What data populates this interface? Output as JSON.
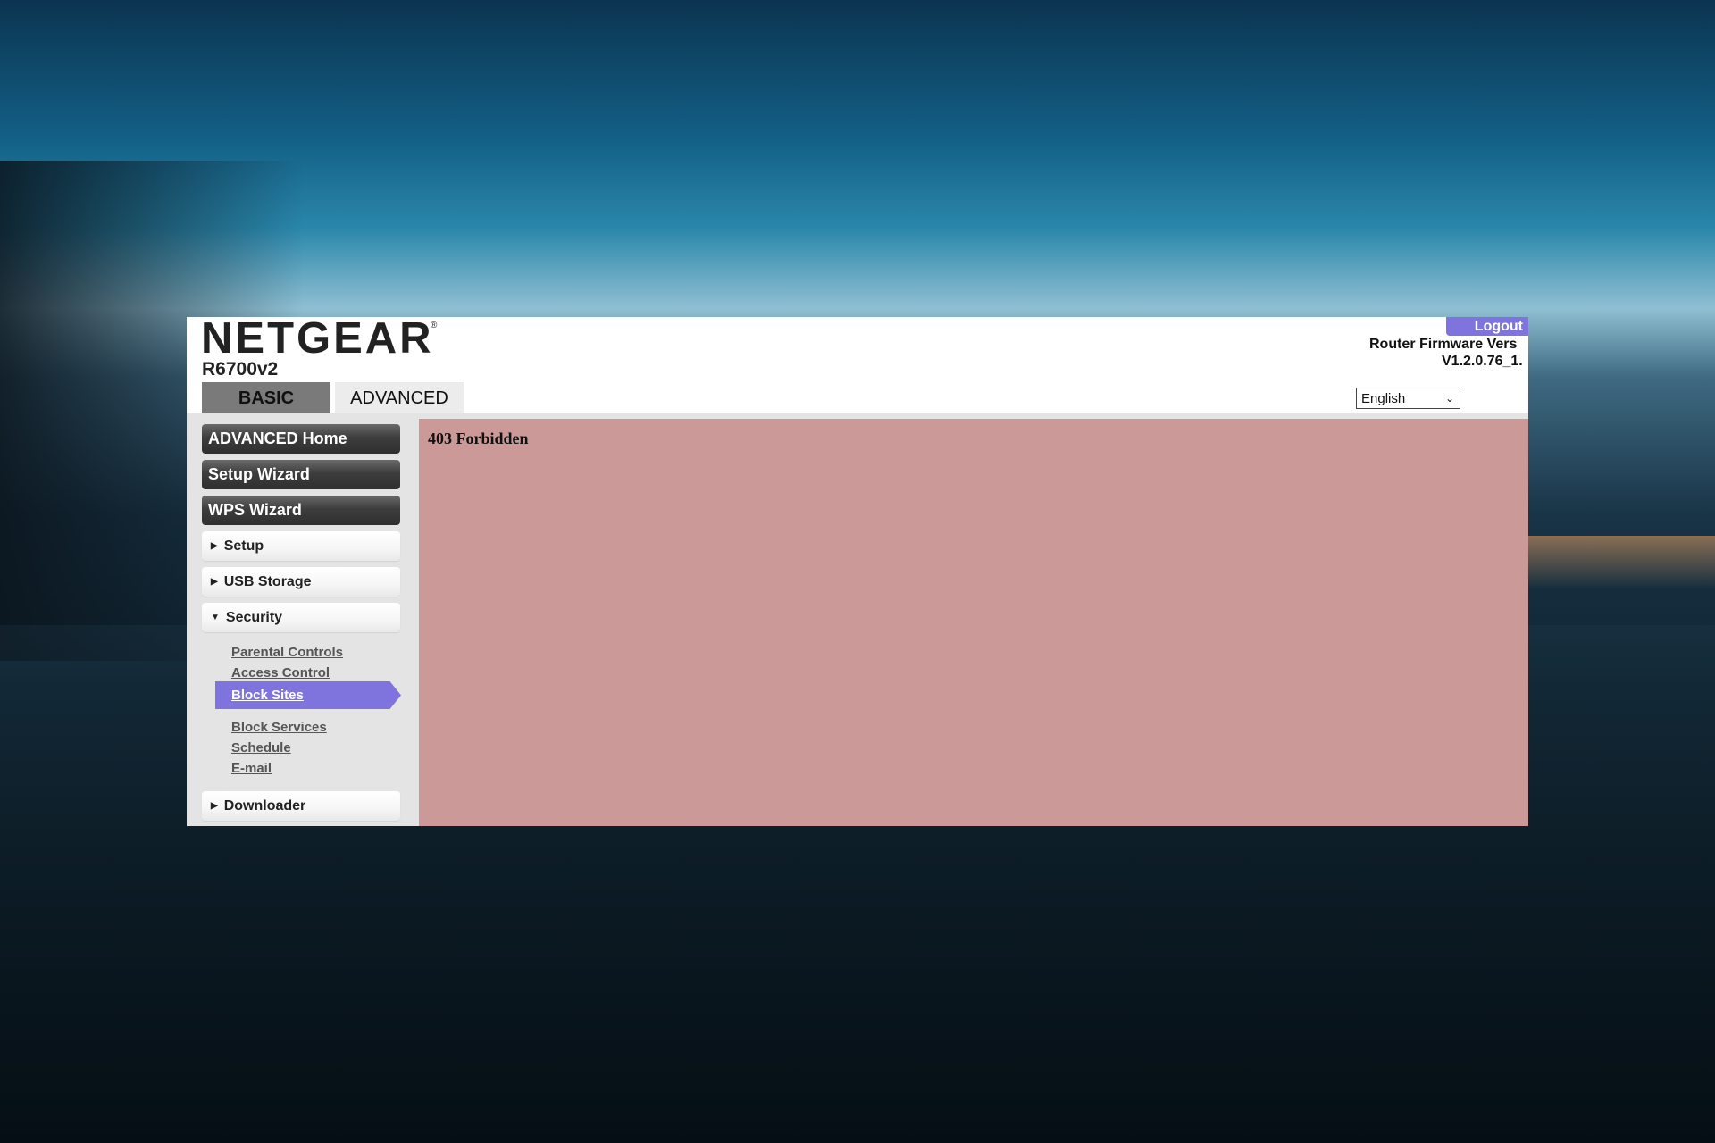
{
  "header": {
    "brand": "NETGEAR",
    "brand_mark": "®",
    "model": "R6700v2",
    "logout_label": "Logout",
    "firmware_title": "Router Firmware Vers",
    "firmware_version": "V1.2.0.76_1.",
    "language_selected": "English"
  },
  "tabs": {
    "basic": "BASIC",
    "advanced": "ADVANCED"
  },
  "sidebar": {
    "advanced_home": "ADVANCED Home",
    "setup_wizard": "Setup Wizard",
    "wps_wizard": "WPS Wizard",
    "setup": "Setup",
    "usb_storage": "USB Storage",
    "security": "Security",
    "security_items": {
      "parental_controls": "Parental Controls",
      "access_control": "Access Control",
      "block_sites": "Block Sites",
      "block_services": "Block Services",
      "schedule": "Schedule",
      "email": "E-mail"
    },
    "downloader": "Downloader"
  },
  "content": {
    "error": "403 Forbidden"
  },
  "colors": {
    "accent": "#7f74dd",
    "content_bg": "#cc9999"
  }
}
